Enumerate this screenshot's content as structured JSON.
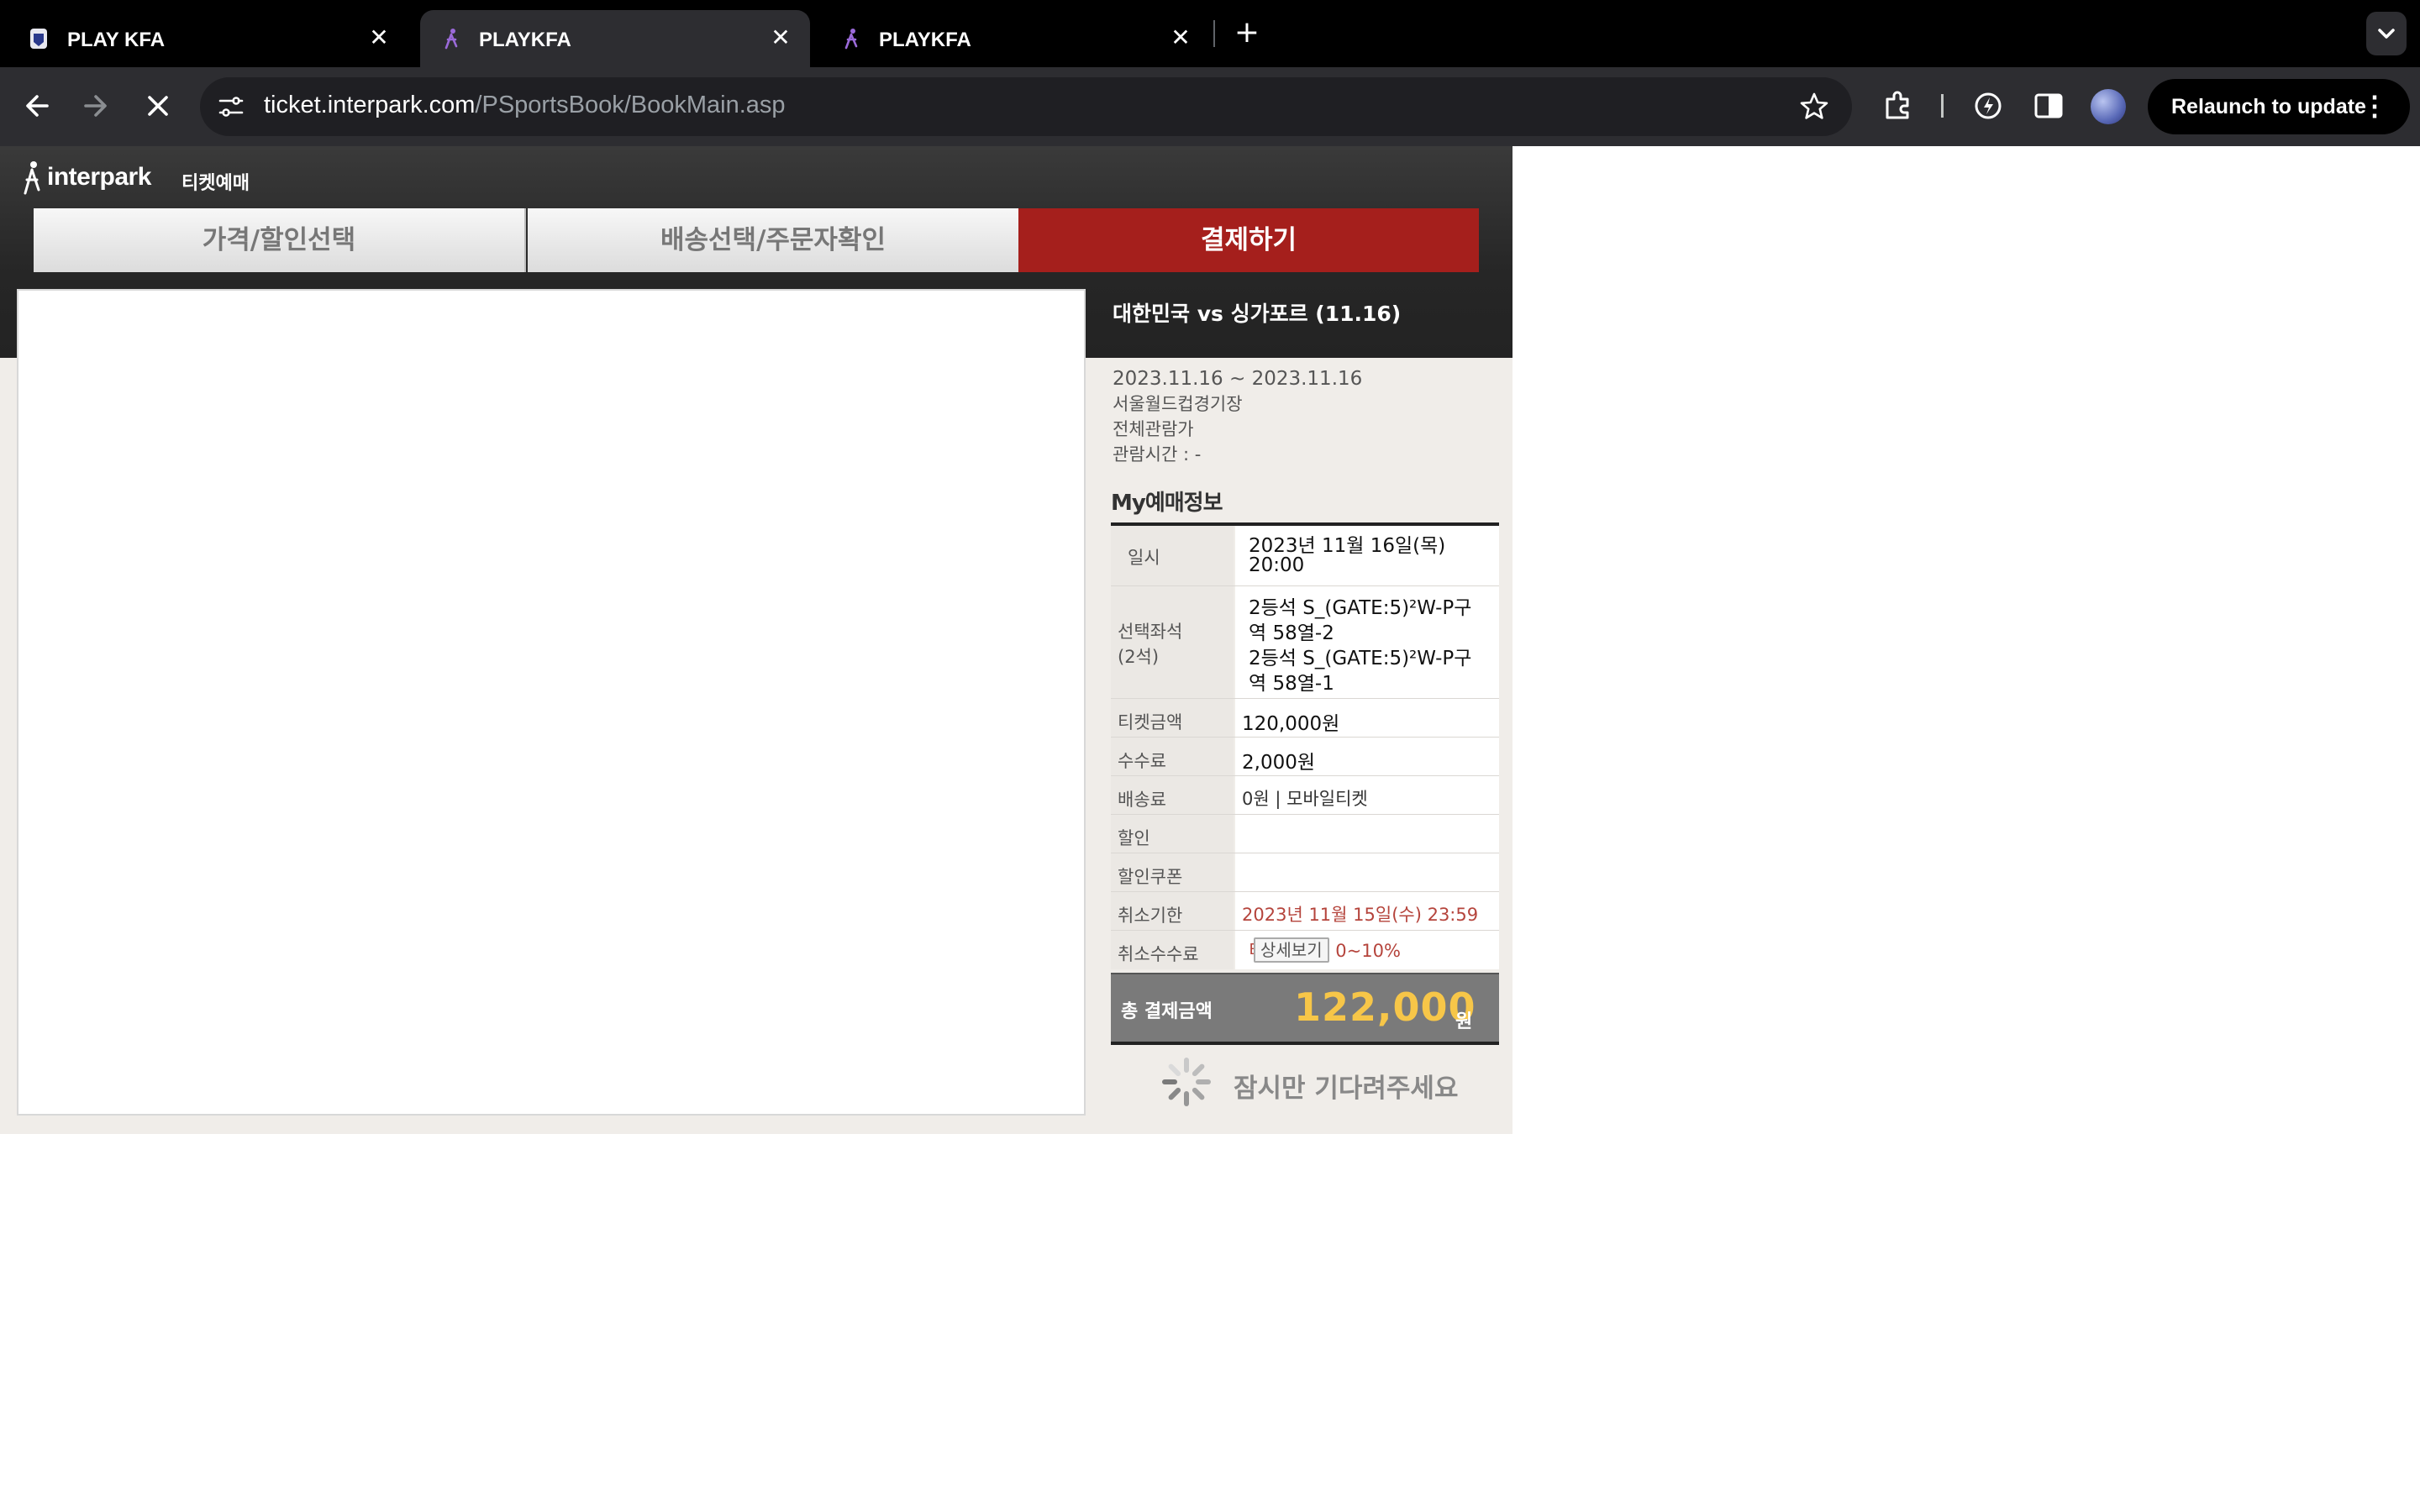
{
  "browser": {
    "tabs": [
      {
        "title": "PLAY KFA",
        "active": false
      },
      {
        "title": "PLAYKFA",
        "active": true
      },
      {
        "title": "PLAYKFA",
        "active": false
      }
    ],
    "url_host": "ticket.interpark.com",
    "url_path": "/PSportsBook/BookMain.asp",
    "relaunch_label": "Relaunch to update"
  },
  "site": {
    "logo_word": "interpark",
    "logo_kor": "티켓예매"
  },
  "steps": [
    {
      "label": "가격/할인선택",
      "active": false
    },
    {
      "label": "배송선택/주문자확인",
      "active": false
    },
    {
      "label": "결제하기",
      "active": true
    }
  ],
  "event": {
    "title": "대한민국 vs 싱가포르 (11.16)",
    "period": "2023.11.16 ~ 2023.11.16",
    "venue": "서울월드컵경기장",
    "rating": "전체관람가",
    "runtime": "관람시간 : -"
  },
  "my_booking": {
    "heading": "My예매정보",
    "rows": [
      {
        "label": "일시",
        "value_lines": [
          "2023년 11월 16일(목)",
          "20:00"
        ]
      },
      {
        "label_lines": [
          "선택좌석",
          "(2석)"
        ],
        "value_lines": [
          "2등석 S_(GATE:5)²W-P구",
          "역 58열-2",
          "2등석 S_(GATE:5)²W-P구",
          "역 58열-1"
        ]
      },
      {
        "label": "티켓금액",
        "value": "120,000원"
      },
      {
        "label": "수수료",
        "value": "2,000원"
      },
      {
        "label": "배송료",
        "value": "0원 | 모바일티켓"
      },
      {
        "label": "할인",
        "value": ""
      },
      {
        "label": "할인쿠폰",
        "value": ""
      },
      {
        "label": "취소기한",
        "value": "2023년 11월 15일(수) 23:59"
      },
      {
        "label": "취소수수료",
        "value": "티켓금액의 0~10%",
        "button": "상세보기"
      }
    ],
    "total_label": "총 결제금액",
    "total_amount": "122,000",
    "total_unit": "원"
  },
  "wait_text": "잠시만 기다려주세요",
  "colors": {
    "accent_step": "#a51f1c",
    "total_amount": "#f7c648",
    "cancel_text": "#b5443c"
  }
}
